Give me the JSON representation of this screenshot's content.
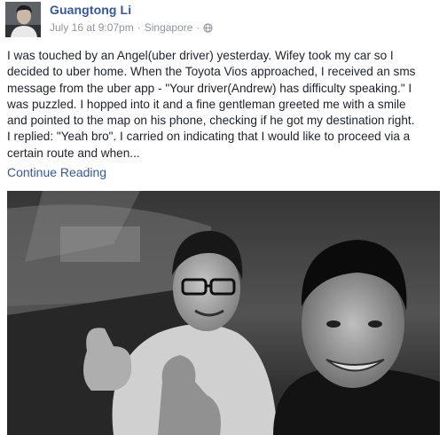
{
  "post": {
    "author": "Guangtong Li",
    "timestamp": "July 16 at 9:07pm",
    "separator": "·",
    "location": "Singapore",
    "text_lines": [
      "I was touched by an Angel(uber driver) yesterday. Wifey took my car so I",
      "decided to uber home. When the Toyota Vios approached, I received an sms",
      "message from the uber app - \"Your driver(Andrew) has difficulty speaking.\" I",
      "was puzzled. I hopped into it and a fine gentleman greeted me with a smile",
      "and pointed to the map on his phone, checking if he got my destination right.",
      "I replied: \"Yeah bro\". I carried on indicating that I would like to proceed via a",
      "certain route and when..."
    ],
    "continue_label": "Continue Reading"
  },
  "icons": {
    "privacy": "globe-icon"
  },
  "colors": {
    "link": "#365899",
    "meta": "#90949c",
    "text": "#1d2129"
  }
}
